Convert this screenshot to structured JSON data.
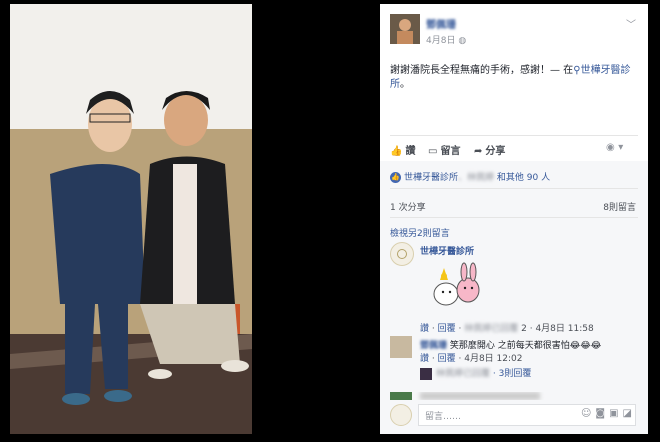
{
  "post": {
    "author": "鄧佩珊",
    "time": "4月8日",
    "chevron": "﹀",
    "text": "謝謝潘院長全程無痛的手術，感謝！— 在",
    "place": "世樺牙醫診所",
    "place_suffix": "。"
  },
  "actions": {
    "like": "讚",
    "comment": "留言",
    "share": "分享"
  },
  "likes": {
    "page": "世樺牙醫診所",
    "names": "、林佩婷",
    "suffix": "和其他 90 人"
  },
  "stats": {
    "shares": "1 次分享",
    "comments": "8則留言"
  },
  "comments_more": "檢視另2則留言",
  "comment1": {
    "name": "世樺牙醫診所",
    "like": "讚",
    "reply": "回覆",
    "who": "林佩婷已回覆",
    "count_badge": "2",
    "time": "4月8日 11:58"
  },
  "comment2": {
    "name": "鄧佩珊",
    "text": "笑那麼開心 之前每天都很害怕😂😂😂",
    "like": "讚",
    "reply": "回覆",
    "time": "4月8日 12:02"
  },
  "replies": {
    "who": "林佩婷已回覆",
    "count": "3則回覆"
  },
  "input": {
    "placeholder": "留言……"
  },
  "icons": {
    "like": "thumbs-up-icon",
    "comment": "comment-icon",
    "share": "share-arrow-icon",
    "place": "location-pin-icon"
  }
}
